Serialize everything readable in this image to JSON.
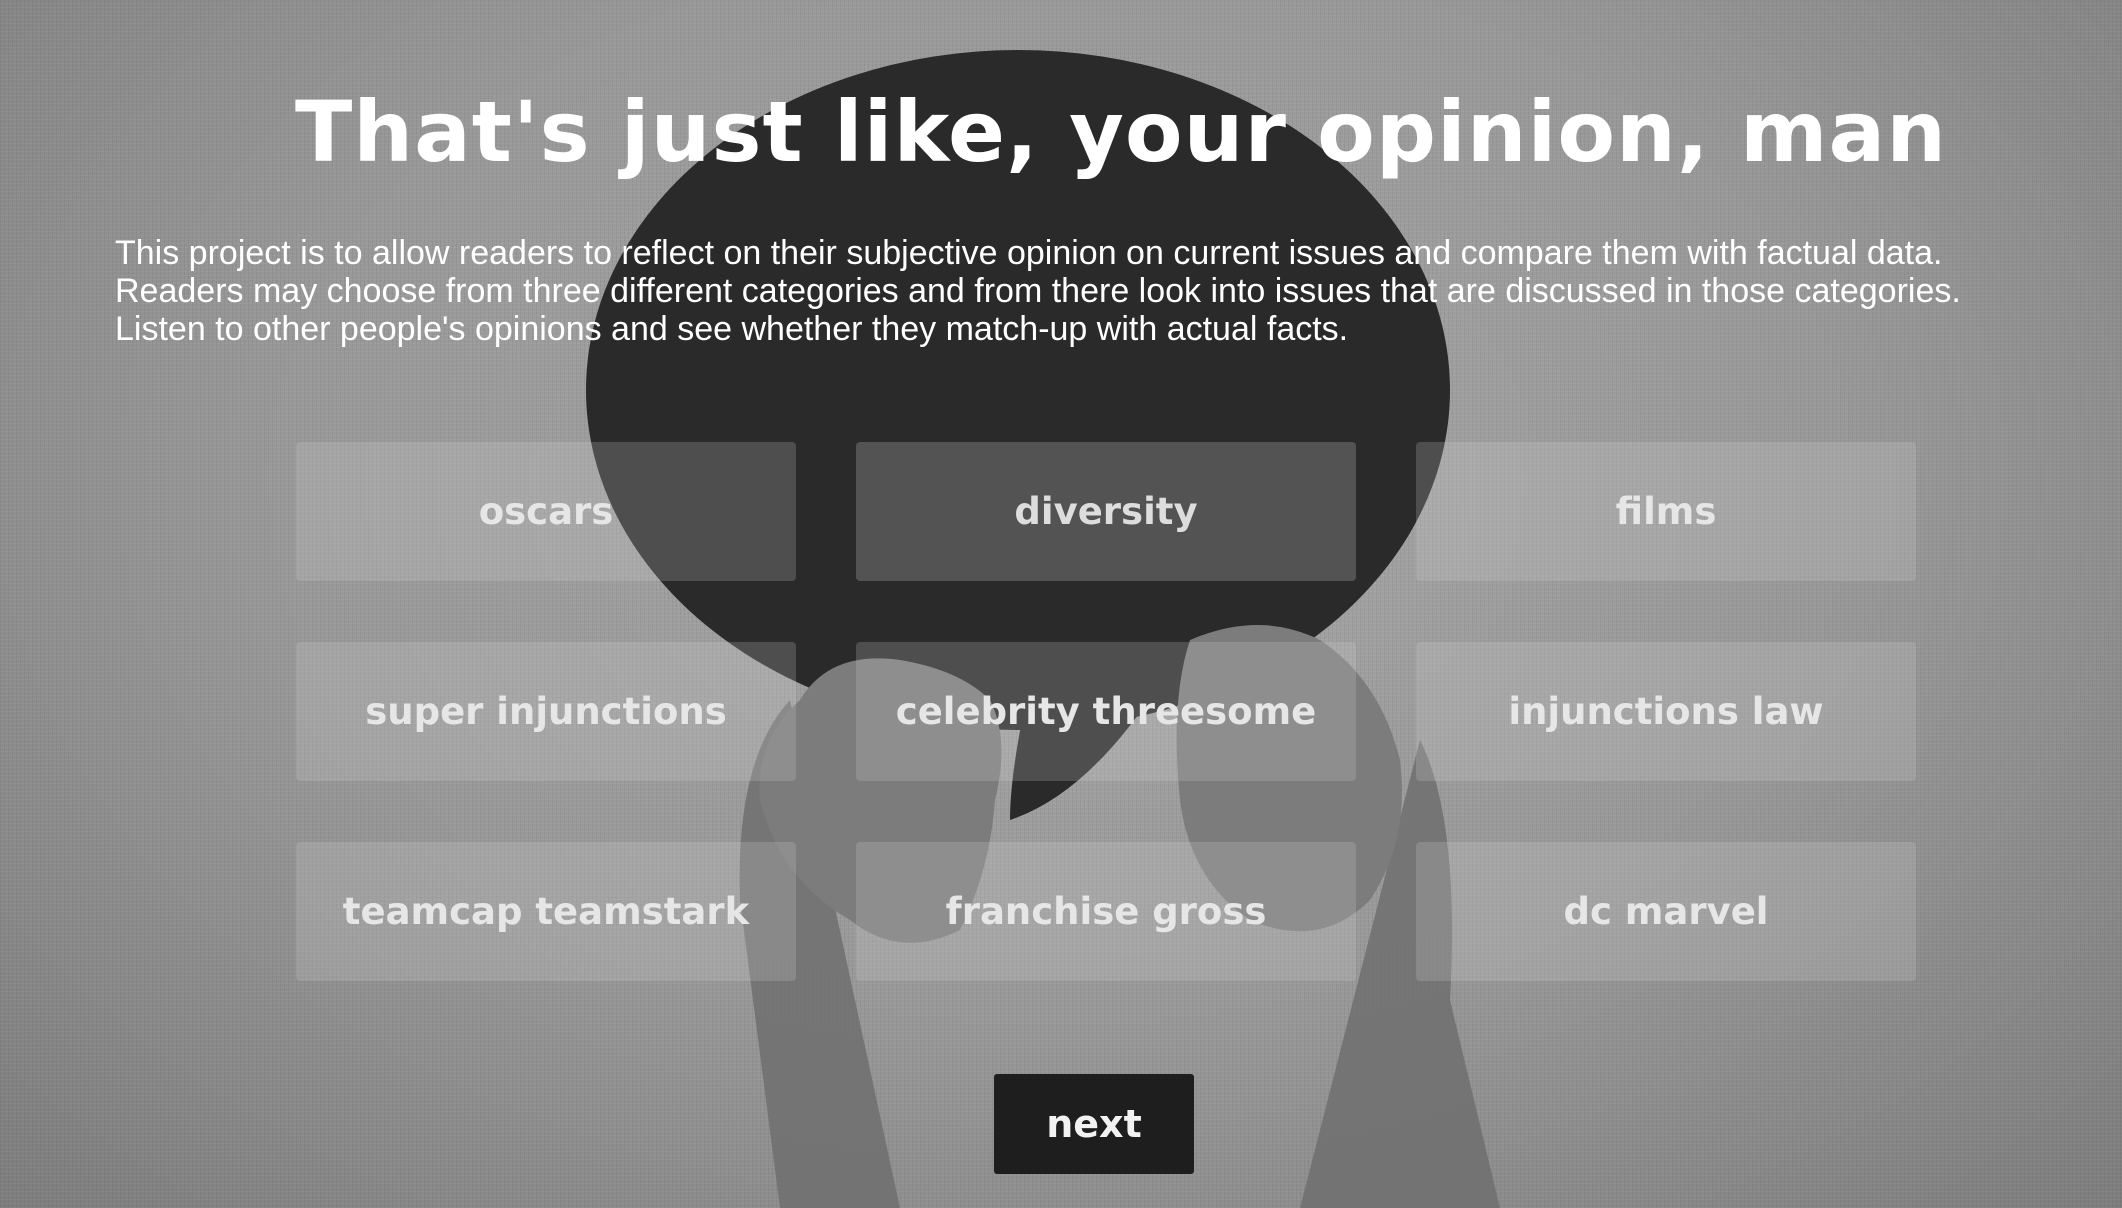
{
  "page": {
    "title": "That's just like, your opinion, man",
    "description": "This project is to allow readers to reflect on their subjective opinion on current issues and compare them with factual data. Readers may choose from three different categories and from there look into issues that are discussed in those categories. Listen to other people's opinions and see whether they match-up with actual facts."
  },
  "categories": [
    {
      "label": "oscars",
      "selected": false
    },
    {
      "label": "diversity",
      "selected": true
    },
    {
      "label": "films",
      "selected": false
    },
    {
      "label": "super injunctions",
      "selected": false
    },
    {
      "label": "celebrity threesome",
      "selected": false
    },
    {
      "label": "injunctions law",
      "selected": false
    },
    {
      "label": "teamcap teamstark",
      "selected": false
    },
    {
      "label": "franchise gross",
      "selected": false
    },
    {
      "label": "dc marvel",
      "selected": false
    }
  ],
  "actions": {
    "next_label": "next"
  },
  "colors": {
    "background": "#9a9a9a",
    "speech_bubble": "#2a2a2a",
    "selected_button": "#5a5a5a",
    "next_button": "#1e1e1e",
    "text": "#ffffff"
  }
}
